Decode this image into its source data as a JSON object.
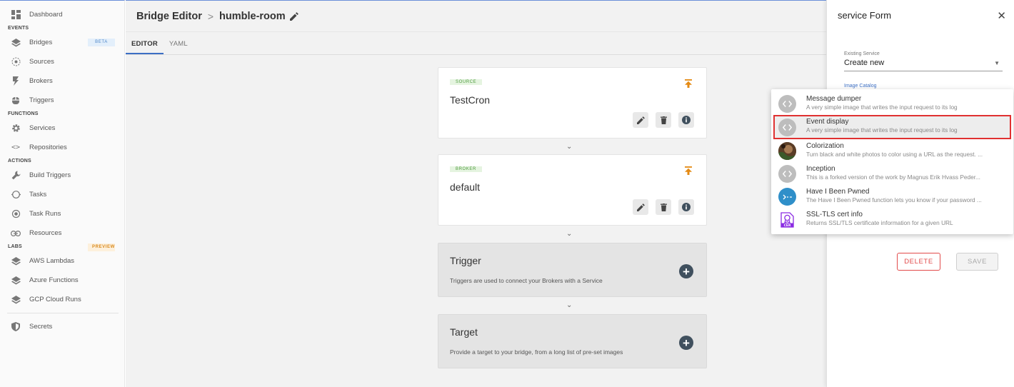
{
  "sidebar": {
    "dashboard": "Dashboard",
    "sections": {
      "events": "EVENTS",
      "functions": "FUNCTIONS",
      "actions": "ACTIONS",
      "labs": "LABS"
    },
    "items": {
      "bridges": "Bridges",
      "sources": "Sources",
      "brokers": "Brokers",
      "triggers": "Triggers",
      "services": "Services",
      "repositories": "Repositories",
      "build_triggers": "Build Triggers",
      "tasks": "Tasks",
      "task_runs": "Task Runs",
      "resources": "Resources",
      "aws_lambdas": "AWS Lambdas",
      "azure_functions": "Azure Functions",
      "gcp_cloud_runs": "GCP Cloud Runs",
      "secrets": "Secrets"
    },
    "badges": {
      "beta": "BETA",
      "preview": "PREVIEW"
    }
  },
  "header": {
    "title": "Bridge Editor",
    "separator": ">",
    "bridge_name": "humble-room"
  },
  "tabs": {
    "editor": "EDITOR",
    "yaml": "YAML"
  },
  "cards": {
    "source": {
      "chip": "SOURCE",
      "title": "TestCron"
    },
    "broker": {
      "chip": "BROKER",
      "title": "default"
    },
    "trigger": {
      "title": "Trigger",
      "description": "Triggers are used to connect your Brokers with a Service"
    },
    "target": {
      "title": "Target",
      "description": "Provide a target to your bridge, from a long list of pre-set images"
    }
  },
  "panel": {
    "title": "service Form",
    "close": "✕",
    "existing_service_label": "Existing Service",
    "existing_service_value": "Create new",
    "image_catalog_label": "Image Catalog",
    "delete_label": "DELETE",
    "save_label": "SAVE"
  },
  "catalog": [
    {
      "name": "Message dumper",
      "description": "A very simple image that writes the input request to its log"
    },
    {
      "name": "Event display",
      "description": "A very simple image that writes the input request to its log"
    },
    {
      "name": "Colorization",
      "description": "Turn black and white photos to color using a URL as the request. ..."
    },
    {
      "name": "Inception",
      "description": "This is a forked version of the work by Magnus Erik Hvass Peder..."
    },
    {
      "name": "Have I Been Pwned",
      "description": "The Have I Been Pwned function lets you know if your password ..."
    },
    {
      "name": "SSL-TLS cert info",
      "description": "Returns SSL/TLS certificate information for a given URL"
    }
  ],
  "colors": {
    "accent": "#3c6fc4",
    "selection_outline": "#e03131",
    "delete": "#e24b4b",
    "pin": "#e48a14",
    "chip_green": "#4c9a3b"
  }
}
